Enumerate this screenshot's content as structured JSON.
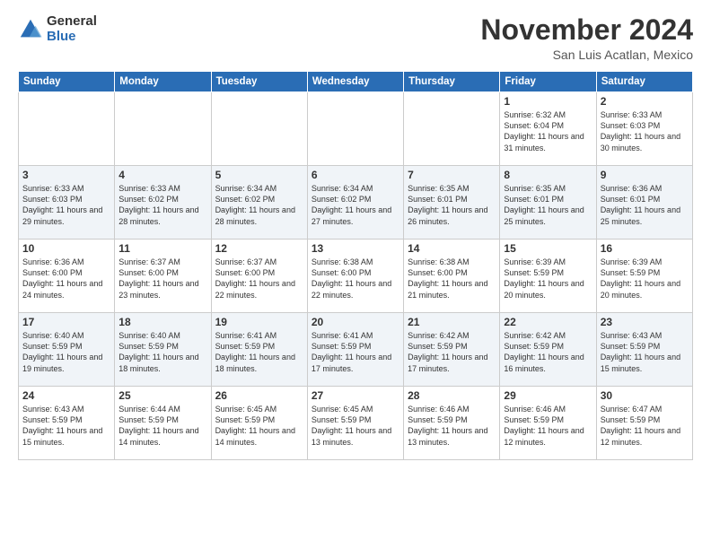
{
  "logo": {
    "general": "General",
    "blue": "Blue"
  },
  "header": {
    "month": "November 2024",
    "location": "San Luis Acatlan, Mexico"
  },
  "days_of_week": [
    "Sunday",
    "Monday",
    "Tuesday",
    "Wednesday",
    "Thursday",
    "Friday",
    "Saturday"
  ],
  "weeks": [
    [
      {
        "day": "",
        "text": ""
      },
      {
        "day": "",
        "text": ""
      },
      {
        "day": "",
        "text": ""
      },
      {
        "day": "",
        "text": ""
      },
      {
        "day": "",
        "text": ""
      },
      {
        "day": "1",
        "text": "Sunrise: 6:32 AM\nSunset: 6:04 PM\nDaylight: 11 hours and 31 minutes."
      },
      {
        "day": "2",
        "text": "Sunrise: 6:33 AM\nSunset: 6:03 PM\nDaylight: 11 hours and 30 minutes."
      }
    ],
    [
      {
        "day": "3",
        "text": "Sunrise: 6:33 AM\nSunset: 6:03 PM\nDaylight: 11 hours and 29 minutes."
      },
      {
        "day": "4",
        "text": "Sunrise: 6:33 AM\nSunset: 6:02 PM\nDaylight: 11 hours and 28 minutes."
      },
      {
        "day": "5",
        "text": "Sunrise: 6:34 AM\nSunset: 6:02 PM\nDaylight: 11 hours and 28 minutes."
      },
      {
        "day": "6",
        "text": "Sunrise: 6:34 AM\nSunset: 6:02 PM\nDaylight: 11 hours and 27 minutes."
      },
      {
        "day": "7",
        "text": "Sunrise: 6:35 AM\nSunset: 6:01 PM\nDaylight: 11 hours and 26 minutes."
      },
      {
        "day": "8",
        "text": "Sunrise: 6:35 AM\nSunset: 6:01 PM\nDaylight: 11 hours and 25 minutes."
      },
      {
        "day": "9",
        "text": "Sunrise: 6:36 AM\nSunset: 6:01 PM\nDaylight: 11 hours and 25 minutes."
      }
    ],
    [
      {
        "day": "10",
        "text": "Sunrise: 6:36 AM\nSunset: 6:00 PM\nDaylight: 11 hours and 24 minutes."
      },
      {
        "day": "11",
        "text": "Sunrise: 6:37 AM\nSunset: 6:00 PM\nDaylight: 11 hours and 23 minutes."
      },
      {
        "day": "12",
        "text": "Sunrise: 6:37 AM\nSunset: 6:00 PM\nDaylight: 11 hours and 22 minutes."
      },
      {
        "day": "13",
        "text": "Sunrise: 6:38 AM\nSunset: 6:00 PM\nDaylight: 11 hours and 22 minutes."
      },
      {
        "day": "14",
        "text": "Sunrise: 6:38 AM\nSunset: 6:00 PM\nDaylight: 11 hours and 21 minutes."
      },
      {
        "day": "15",
        "text": "Sunrise: 6:39 AM\nSunset: 5:59 PM\nDaylight: 11 hours and 20 minutes."
      },
      {
        "day": "16",
        "text": "Sunrise: 6:39 AM\nSunset: 5:59 PM\nDaylight: 11 hours and 20 minutes."
      }
    ],
    [
      {
        "day": "17",
        "text": "Sunrise: 6:40 AM\nSunset: 5:59 PM\nDaylight: 11 hours and 19 minutes."
      },
      {
        "day": "18",
        "text": "Sunrise: 6:40 AM\nSunset: 5:59 PM\nDaylight: 11 hours and 18 minutes."
      },
      {
        "day": "19",
        "text": "Sunrise: 6:41 AM\nSunset: 5:59 PM\nDaylight: 11 hours and 18 minutes."
      },
      {
        "day": "20",
        "text": "Sunrise: 6:41 AM\nSunset: 5:59 PM\nDaylight: 11 hours and 17 minutes."
      },
      {
        "day": "21",
        "text": "Sunrise: 6:42 AM\nSunset: 5:59 PM\nDaylight: 11 hours and 17 minutes."
      },
      {
        "day": "22",
        "text": "Sunrise: 6:42 AM\nSunset: 5:59 PM\nDaylight: 11 hours and 16 minutes."
      },
      {
        "day": "23",
        "text": "Sunrise: 6:43 AM\nSunset: 5:59 PM\nDaylight: 11 hours and 15 minutes."
      }
    ],
    [
      {
        "day": "24",
        "text": "Sunrise: 6:43 AM\nSunset: 5:59 PM\nDaylight: 11 hours and 15 minutes."
      },
      {
        "day": "25",
        "text": "Sunrise: 6:44 AM\nSunset: 5:59 PM\nDaylight: 11 hours and 14 minutes."
      },
      {
        "day": "26",
        "text": "Sunrise: 6:45 AM\nSunset: 5:59 PM\nDaylight: 11 hours and 14 minutes."
      },
      {
        "day": "27",
        "text": "Sunrise: 6:45 AM\nSunset: 5:59 PM\nDaylight: 11 hours and 13 minutes."
      },
      {
        "day": "28",
        "text": "Sunrise: 6:46 AM\nSunset: 5:59 PM\nDaylight: 11 hours and 13 minutes."
      },
      {
        "day": "29",
        "text": "Sunrise: 6:46 AM\nSunset: 5:59 PM\nDaylight: 11 hours and 12 minutes."
      },
      {
        "day": "30",
        "text": "Sunrise: 6:47 AM\nSunset: 5:59 PM\nDaylight: 11 hours and 12 minutes."
      }
    ]
  ]
}
